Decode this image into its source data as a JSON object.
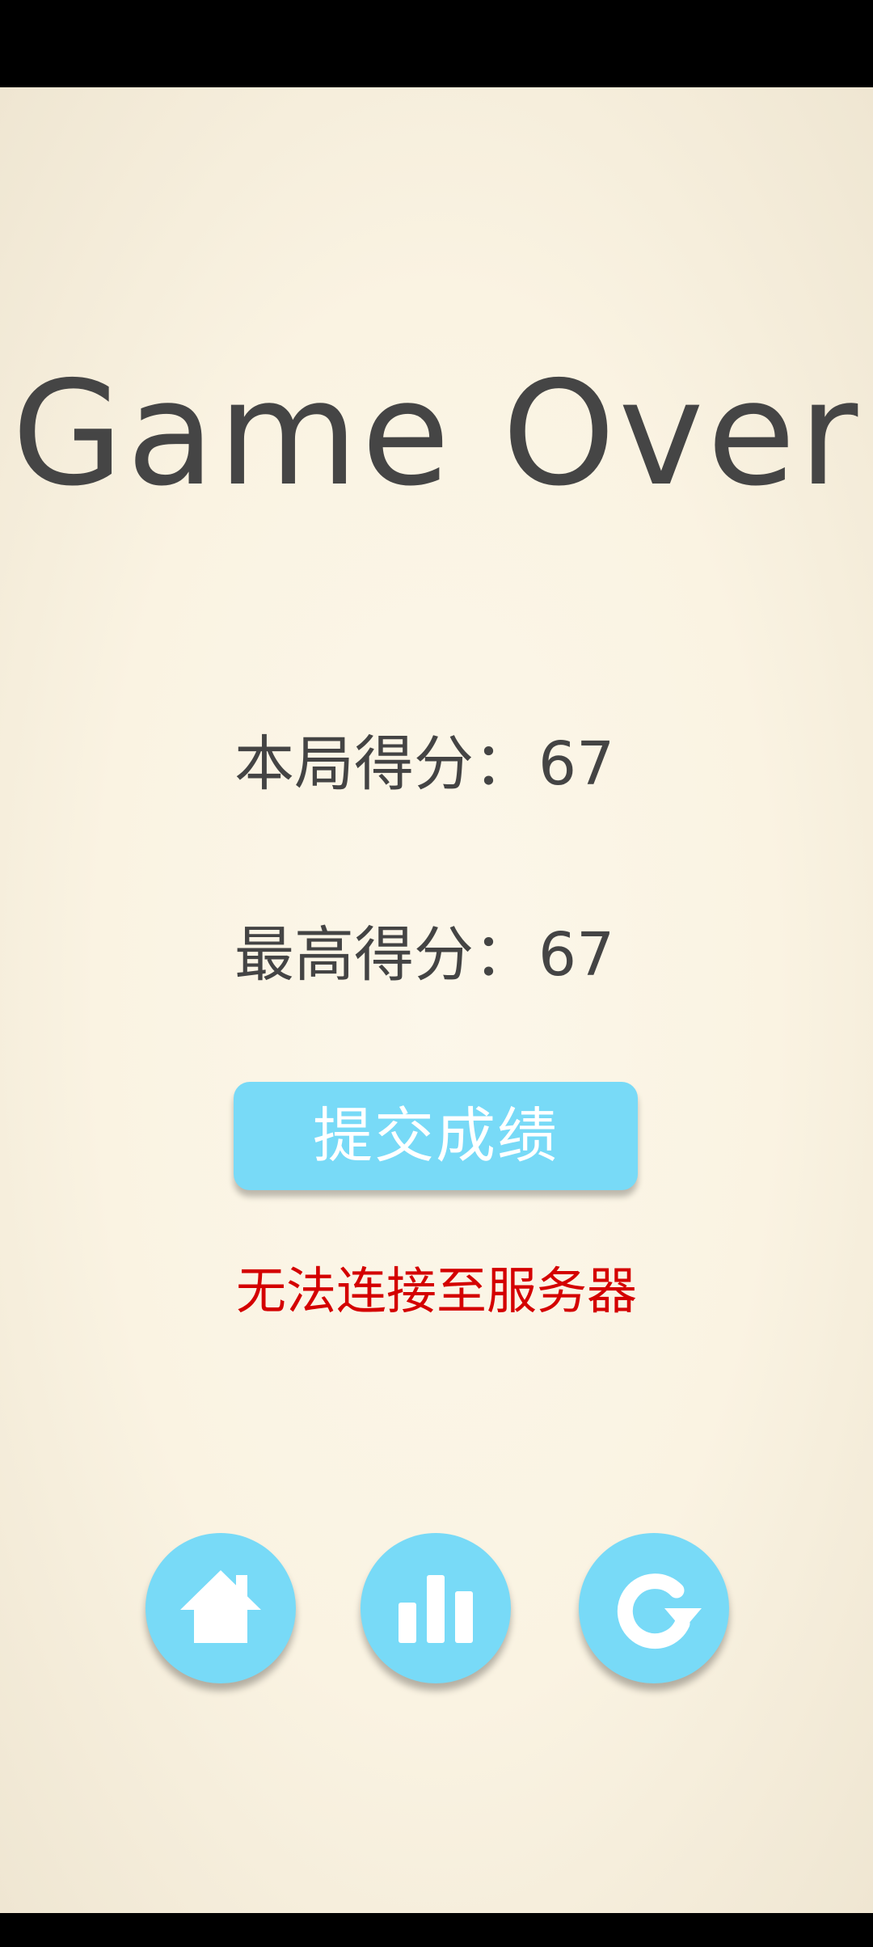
{
  "title": "Game Over",
  "scores": {
    "current_label": "本局得分：",
    "current_value": "67",
    "best_label": "最高得分：",
    "best_value": "67"
  },
  "submit_button_label": "提交成绩",
  "error_message": "无法连接至服务器",
  "icons": {
    "home": "home-icon",
    "stats": "bar-chart-icon",
    "restart": "restart-icon"
  },
  "colors": {
    "accent": "#78daf7",
    "error": "#d40000",
    "text": "#444444",
    "background": "#faf3e2"
  }
}
